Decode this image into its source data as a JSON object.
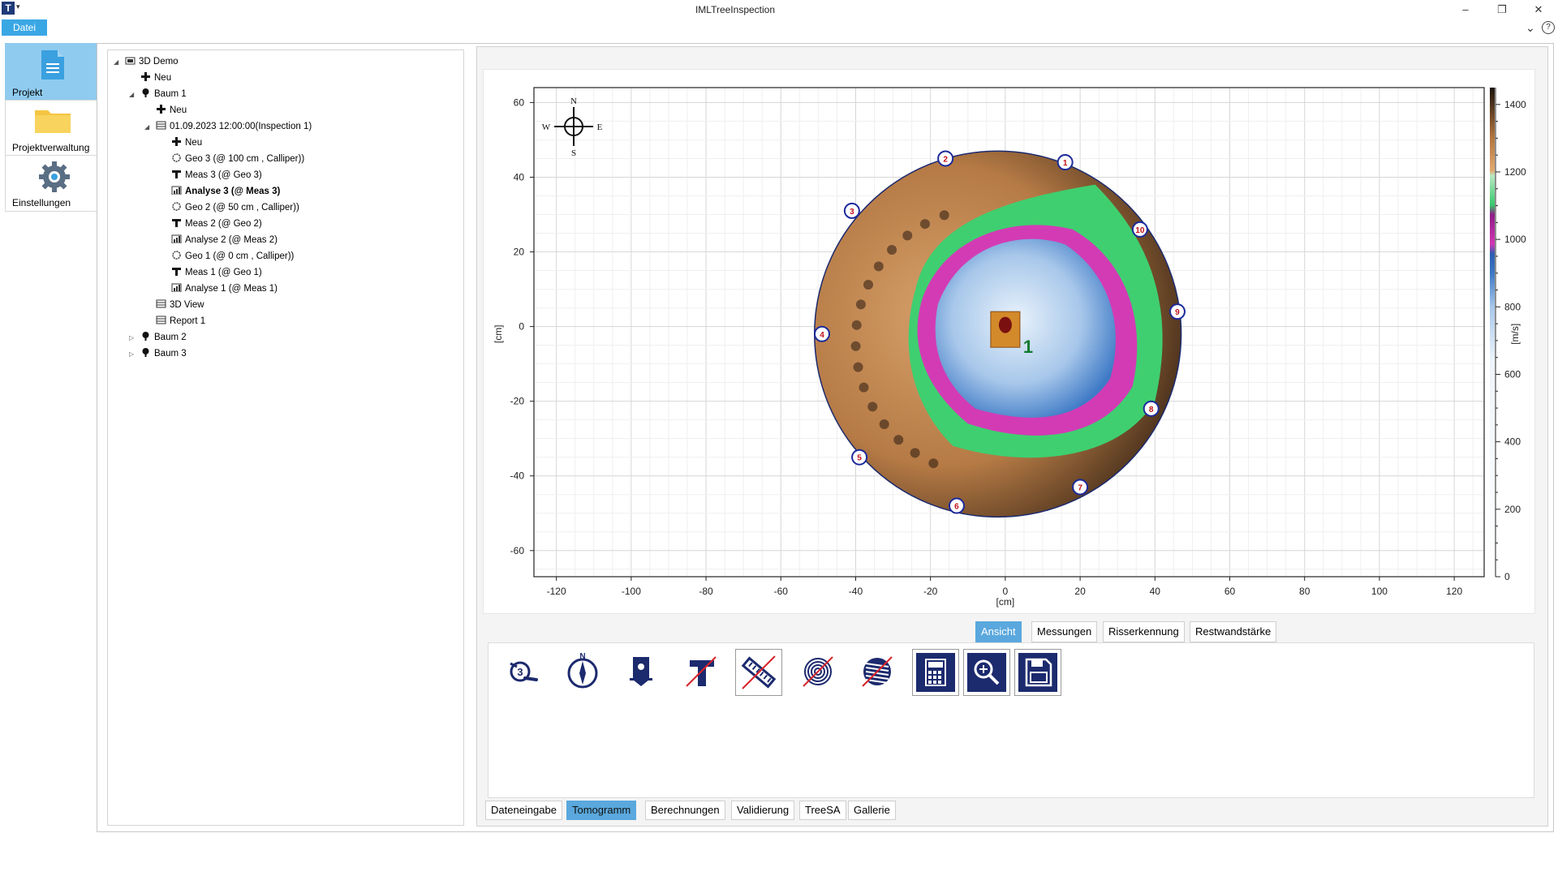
{
  "window": {
    "title": "IMLTreeInspection",
    "menu_datei": "Datei"
  },
  "nav": [
    {
      "label": "Projekt",
      "active": true
    },
    {
      "label": "Projektverwaltung",
      "active": false
    },
    {
      "label": "Einstellungen",
      "active": false
    }
  ],
  "tree": [
    {
      "label": "3D Demo",
      "icon": "project-icon",
      "expanded": true,
      "bold": false
    },
    {
      "label": "Neu",
      "icon": "plus-icon",
      "bold": false
    },
    {
      "label": "Baum 1",
      "icon": "tree-icon",
      "expanded": true,
      "bold": false
    },
    {
      "label": "Neu",
      "icon": "plus-icon",
      "bold": false
    },
    {
      "label": "01.09.2023 12:00:00(Inspection 1)",
      "icon": "table-icon",
      "expanded": true,
      "bold": false
    },
    {
      "label": "Neu",
      "icon": "plus-icon",
      "bold": false
    },
    {
      "label": "Geo 3 (@ 100 cm , Calliper))",
      "icon": "geometry-icon",
      "bold": false
    },
    {
      "label": "Meas 3 (@ Geo 3)",
      "icon": "measurement-icon",
      "bold": false
    },
    {
      "label": "Analyse 3 (@ Meas 3)",
      "icon": "analysis-icon",
      "bold": true
    },
    {
      "label": "Geo 2 (@ 50 cm , Calliper))",
      "icon": "geometry-icon",
      "bold": false
    },
    {
      "label": "Meas 2 (@ Geo 2)",
      "icon": "measurement-icon",
      "bold": false
    },
    {
      "label": "Analyse 2 (@ Meas 2)",
      "icon": "analysis-icon",
      "bold": false
    },
    {
      "label": "Geo 1 (@ 0 cm , Calliper))",
      "icon": "geometry-icon",
      "bold": false
    },
    {
      "label": "Meas 1 (@ Geo 1)",
      "icon": "measurement-icon",
      "bold": false
    },
    {
      "label": "Analyse 1 (@ Meas 1)",
      "icon": "analysis-icon",
      "bold": false
    },
    {
      "label": "3D View",
      "icon": "table-icon",
      "bold": false
    },
    {
      "label": "Report 1",
      "icon": "table-icon",
      "bold": false
    },
    {
      "label": "Baum 2",
      "icon": "tree-icon",
      "expanded": false,
      "bold": false
    },
    {
      "label": "Baum 3",
      "icon": "tree-icon",
      "expanded": false,
      "bold": false
    }
  ],
  "subtabs": [
    {
      "label": "Ansicht",
      "active": true
    },
    {
      "label": "Messungen",
      "active": false
    },
    {
      "label": "Risserkennung",
      "active": false
    },
    {
      "label": "Restwandstärke",
      "active": false
    }
  ],
  "bottom_tabs": [
    {
      "label": "Dateneingabe",
      "active": false
    },
    {
      "label": "Tomogramm",
      "active": true
    },
    {
      "label": "Berechnungen",
      "active": false
    },
    {
      "label": "Validierung",
      "active": false
    },
    {
      "label": "TreeSA",
      "active": false
    },
    {
      "label": "Gallerie",
      "active": false
    }
  ],
  "tools": [
    {
      "icon": "sensor-number-icon"
    },
    {
      "icon": "compass-north-icon"
    },
    {
      "icon": "tree-marker-icon"
    },
    {
      "icon": "crack-disabled-icon"
    },
    {
      "icon": "ruler-disabled-icon"
    },
    {
      "icon": "rings-disabled-icon"
    },
    {
      "icon": "wood-disabled-icon"
    },
    {
      "icon": "calculator-icon"
    },
    {
      "icon": "zoom-icon"
    },
    {
      "icon": "save-icon"
    }
  ],
  "chart_data": {
    "type": "heatmap",
    "xlabel": "[cm]",
    "ylabel": "[cm]",
    "x_ticks": [
      -120,
      -100,
      -80,
      -60,
      -40,
      -20,
      0,
      20,
      40,
      60,
      80,
      100,
      120
    ],
    "y_ticks": [
      60,
      40,
      20,
      0,
      -20,
      -40,
      -60
    ],
    "xlim": [
      -126,
      128
    ],
    "ylim": [
      -67,
      64
    ],
    "grid": true,
    "colorbar": {
      "label": "[m/s]",
      "ticks": [
        1400,
        1200,
        1000,
        800,
        600,
        400,
        200,
        0
      ],
      "range": [
        0,
        1450
      ]
    },
    "compass": {
      "N": "N",
      "S": "S",
      "E": "E",
      "W": "W"
    },
    "sensors": [
      {
        "label": "1",
        "x": 16,
        "y": 44
      },
      {
        "label": "2",
        "x": -16,
        "y": 45
      },
      {
        "label": "3",
        "x": -41,
        "y": 31
      },
      {
        "label": "4",
        "x": -49,
        "y": -2
      },
      {
        "label": "5",
        "x": -39,
        "y": -35
      },
      {
        "label": "6",
        "x": -13,
        "y": -48
      },
      {
        "label": "7",
        "x": 20,
        "y": -43
      },
      {
        "label": "8",
        "x": 39,
        "y": -22
      },
      {
        "label": "9",
        "x": 46,
        "y": 4
      },
      {
        "label": "10",
        "x": 36,
        "y": 26
      }
    ],
    "tree_marker": {
      "label": "1",
      "x": 0,
      "y": 0
    }
  }
}
